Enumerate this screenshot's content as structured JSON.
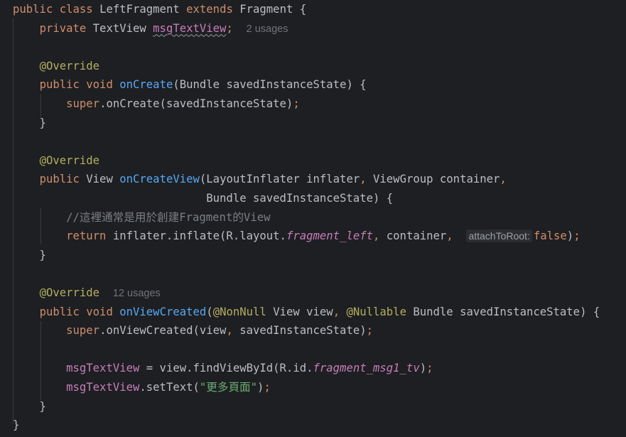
{
  "editor": {
    "lines": [
      {
        "tokens": [
          {
            "cls": "kw",
            "text": "public class "
          },
          {
            "cls": "",
            "text": "LeftFragment "
          },
          {
            "cls": "kw",
            "text": "extends "
          },
          {
            "cls": "",
            "text": "Fragment {"
          }
        ]
      },
      {
        "tokens": [
          {
            "cls": "",
            "text": "    "
          },
          {
            "cls": "kw",
            "text": "private "
          },
          {
            "cls": "",
            "text": "TextView "
          },
          {
            "cls": "fldu",
            "text": "msgTextView"
          },
          {
            "cls": "kw",
            "text": ";"
          },
          {
            "cls": "",
            "text": "  "
          },
          {
            "cls": "hint-usage",
            "text": "2 usages",
            "name": "usage-hint"
          }
        ]
      },
      {
        "tokens": []
      },
      {
        "tokens": [
          {
            "cls": "",
            "text": "    "
          },
          {
            "cls": "ann",
            "text": "@Override"
          }
        ]
      },
      {
        "tokens": [
          {
            "cls": "",
            "text": "    "
          },
          {
            "cls": "kw",
            "text": "public void "
          },
          {
            "cls": "fn",
            "text": "onCreate"
          },
          {
            "cls": "",
            "text": "(Bundle savedInstanceState) {"
          }
        ]
      },
      {
        "tokens": [
          {
            "cls": "",
            "text": "        "
          },
          {
            "cls": "kw",
            "text": "super"
          },
          {
            "cls": "",
            "text": ".onCreate(savedInstanceState)"
          },
          {
            "cls": "kw",
            "text": ";"
          }
        ]
      },
      {
        "tokens": [
          {
            "cls": "",
            "text": "    }"
          }
        ]
      },
      {
        "tokens": []
      },
      {
        "tokens": [
          {
            "cls": "",
            "text": "    "
          },
          {
            "cls": "ann",
            "text": "@Override"
          }
        ]
      },
      {
        "tokens": [
          {
            "cls": "",
            "text": "    "
          },
          {
            "cls": "kw",
            "text": "public "
          },
          {
            "cls": "",
            "text": "View "
          },
          {
            "cls": "fn",
            "text": "onCreateView"
          },
          {
            "cls": "",
            "text": "(LayoutInflater inflater"
          },
          {
            "cls": "kw",
            "text": ", "
          },
          {
            "cls": "",
            "text": "ViewGroup container"
          },
          {
            "cls": "kw",
            "text": ","
          }
        ]
      },
      {
        "tokens": [
          {
            "cls": "",
            "text": "                             Bundle savedInstanceState) {"
          }
        ]
      },
      {
        "tokens": [
          {
            "cls": "",
            "text": "        "
          },
          {
            "cls": "cmt",
            "text": "//這裡通常是用於創建Fragment的View"
          }
        ]
      },
      {
        "tokens": [
          {
            "cls": "",
            "text": "        "
          },
          {
            "cls": "kw",
            "text": "return "
          },
          {
            "cls": "",
            "text": "inflater.inflate(R.layout."
          },
          {
            "cls": "sfld",
            "text": "fragment_left"
          },
          {
            "cls": "kw",
            "text": ", "
          },
          {
            "cls": "",
            "text": "container"
          },
          {
            "cls": "kw",
            "text": ", "
          },
          {
            "cls": "",
            "text": " "
          },
          {
            "cls": "param-hint",
            "text": "attachToRoot:",
            "name": "param-hint"
          },
          {
            "cls": "kw",
            "text": "false"
          },
          {
            "cls": "",
            "text": ")"
          },
          {
            "cls": "kw",
            "text": ";"
          }
        ]
      },
      {
        "tokens": [
          {
            "cls": "",
            "text": "    }"
          }
        ]
      },
      {
        "tokens": []
      },
      {
        "tokens": [
          {
            "cls": "",
            "text": "    "
          },
          {
            "cls": "ann",
            "text": "@Override"
          },
          {
            "cls": "",
            "text": "  "
          },
          {
            "cls": "hint-usage",
            "text": "12 usages",
            "name": "usage-hint"
          }
        ]
      },
      {
        "tokens": [
          {
            "cls": "",
            "text": "    "
          },
          {
            "cls": "kw",
            "text": "public void "
          },
          {
            "cls": "fn",
            "text": "onViewCreated"
          },
          {
            "cls": "",
            "text": "("
          },
          {
            "cls": "ann",
            "text": "@NonNull "
          },
          {
            "cls": "",
            "text": "View view"
          },
          {
            "cls": "kw",
            "text": ", "
          },
          {
            "cls": "ann",
            "text": "@Nullable "
          },
          {
            "cls": "",
            "text": "Bundle savedInstanceState) {"
          }
        ]
      },
      {
        "tokens": [
          {
            "cls": "",
            "text": "        "
          },
          {
            "cls": "kw",
            "text": "super"
          },
          {
            "cls": "",
            "text": ".onViewCreated(view"
          },
          {
            "cls": "kw",
            "text": ", "
          },
          {
            "cls": "",
            "text": "savedInstanceState)"
          },
          {
            "cls": "kw",
            "text": ";"
          }
        ]
      },
      {
        "tokens": []
      },
      {
        "tokens": [
          {
            "cls": "",
            "text": "        "
          },
          {
            "cls": "fld",
            "text": "msgTextView "
          },
          {
            "cls": "",
            "text": "= view.findViewById(R.id."
          },
          {
            "cls": "sfld",
            "text": "fragment_msg1_tv"
          },
          {
            "cls": "",
            "text": ")"
          },
          {
            "cls": "kw",
            "text": ";"
          }
        ]
      },
      {
        "tokens": [
          {
            "cls": "",
            "text": "        "
          },
          {
            "cls": "fld",
            "text": "msgTextView"
          },
          {
            "cls": "",
            "text": ".setText("
          },
          {
            "cls": "str",
            "text": "\"更多頁面\""
          },
          {
            "cls": "",
            "text": ")"
          },
          {
            "cls": "kw",
            "text": ";"
          }
        ]
      },
      {
        "tokens": [
          {
            "cls": "",
            "text": "    }"
          }
        ]
      },
      {
        "tokens": [
          {
            "cls": "",
            "text": "}"
          }
        ]
      }
    ]
  },
  "colors": {
    "background": "#1e1f22",
    "keyword": "#cf8e6d",
    "function": "#56a8f5",
    "annotation": "#b3ae60",
    "field": "#c77dbb",
    "comment": "#7a7e85",
    "string": "#6aab73",
    "default": "#bcbec4"
  }
}
